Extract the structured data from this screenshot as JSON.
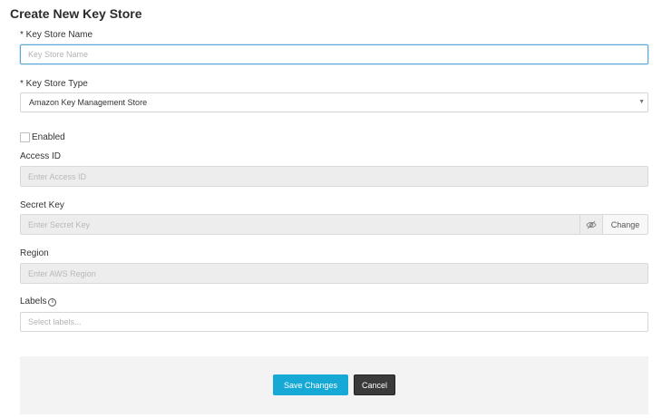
{
  "page": {
    "title": "Create New Key Store"
  },
  "form": {
    "key_store_name": {
      "label": "* Key Store Name",
      "placeholder": "Key Store Name",
      "value": ""
    },
    "key_store_type": {
      "label": "* Key Store Type",
      "selected": "Amazon Key Management Store"
    },
    "enabled": {
      "label": "Enabled",
      "checked": false
    },
    "access_id": {
      "label": "Access ID",
      "placeholder": "Enter Access ID"
    },
    "secret_key": {
      "label": "Secret Key",
      "placeholder": "Enter Secret Key",
      "toggle_icon": "eye-slash-icon",
      "change_label": "Change"
    },
    "region": {
      "label": "Region",
      "placeholder": "Enter AWS Region"
    },
    "labels": {
      "label": "Labels",
      "info_icon": "info-icon",
      "placeholder": "Select labels..."
    }
  },
  "footer": {
    "save_label": "Save Changes",
    "cancel_label": "Cancel"
  },
  "colors": {
    "accent": "#17a9d6",
    "cancel": "#3a3a3a",
    "focus_border": "#5ba7d8",
    "disabled_bg": "#ededed"
  }
}
